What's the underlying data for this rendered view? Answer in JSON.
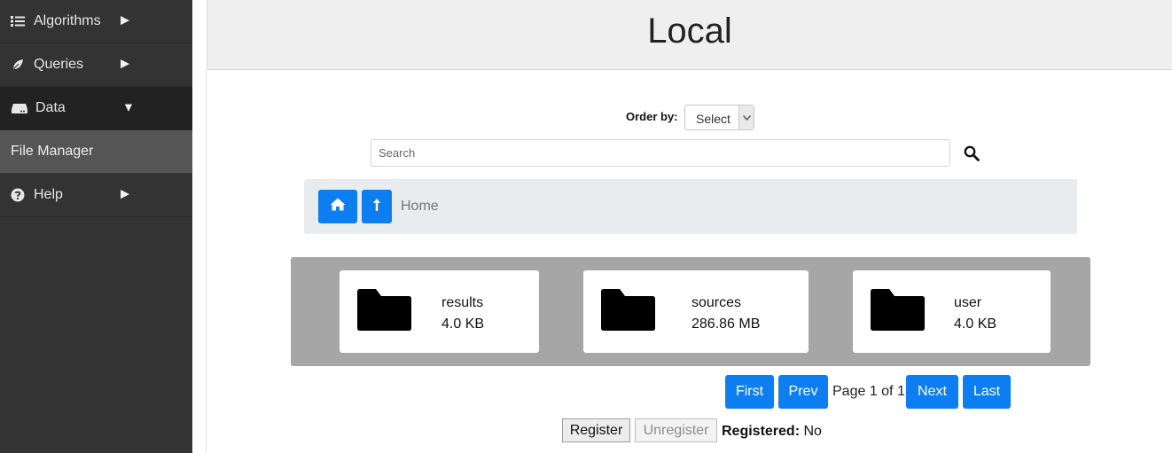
{
  "sidebar": {
    "items": [
      {
        "label": "Algorithms",
        "icon": "list-icon",
        "arrow": "▶"
      },
      {
        "label": "Queries",
        "icon": "leaf-icon",
        "arrow": "▶"
      },
      {
        "label": "Data",
        "icon": "hdd-icon",
        "arrow": "▼"
      },
      {
        "label": "Help",
        "icon": "question-circle-icon",
        "arrow": "▶"
      }
    ],
    "sub_item": "File Manager"
  },
  "header": {
    "title": "Local"
  },
  "toolbar": {
    "order_label": "Order by:",
    "order_value": "Select",
    "search_placeholder": "Search"
  },
  "breadcrumb": {
    "current": "Home"
  },
  "files": [
    {
      "name": "results",
      "size": "4.0 KB"
    },
    {
      "name": "sources",
      "size": "286.86 MB"
    },
    {
      "name": "user",
      "size": "4.0 KB"
    }
  ],
  "pagination": {
    "first": "First",
    "prev": "Prev",
    "page_text": "Page 1 of 1",
    "next": "Next",
    "last": "Last"
  },
  "registration": {
    "register_label": "Register",
    "unregister_label": "Unregister",
    "status_label": "Registered:",
    "status_value": "No"
  },
  "colors": {
    "accent": "#0d7ef0",
    "sidebar_bg": "#333333",
    "panel_bg": "#a6a6a6"
  }
}
